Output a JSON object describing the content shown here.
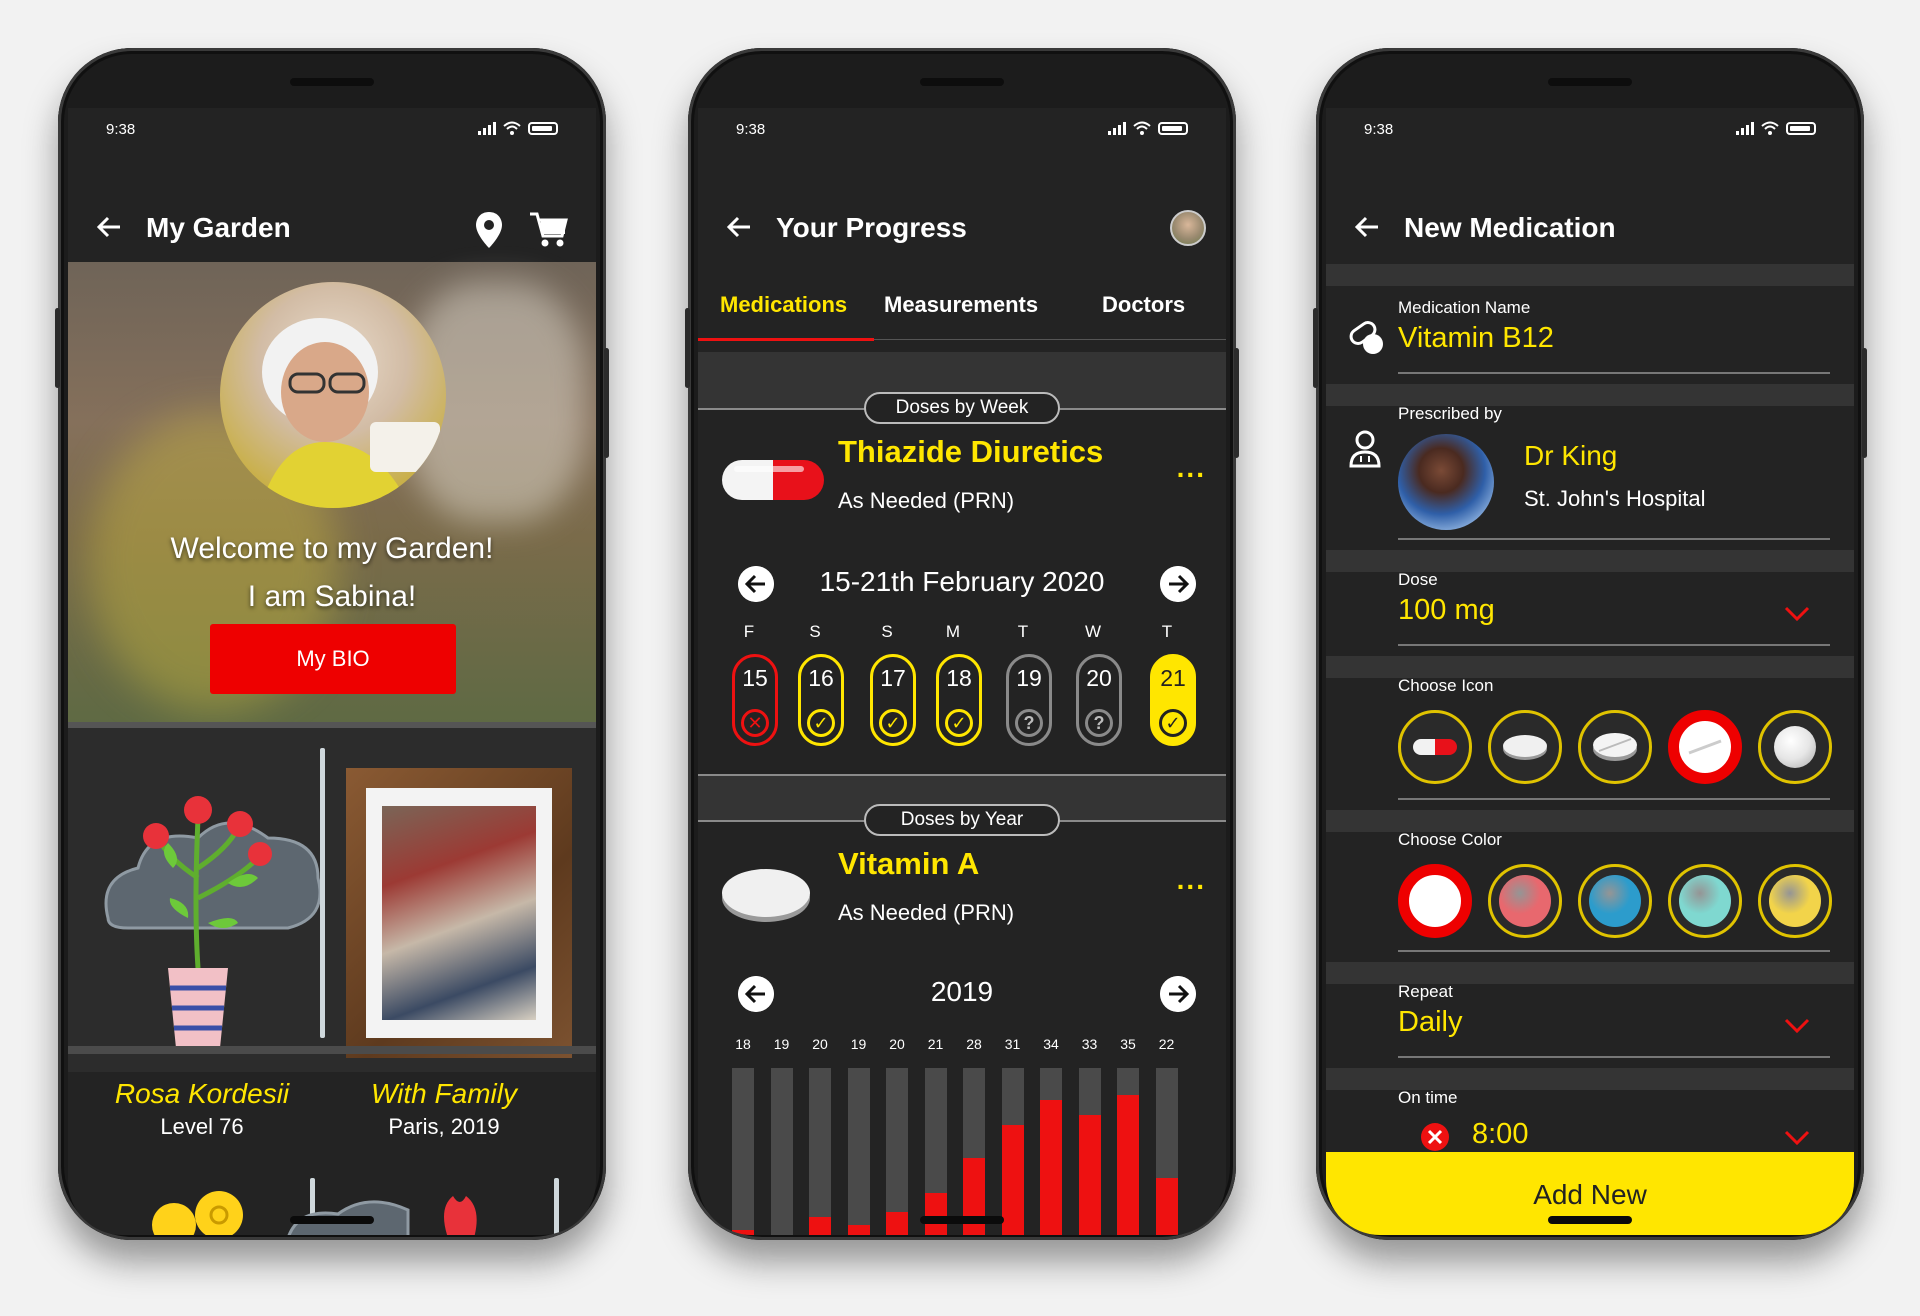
{
  "status": {
    "time": "9:38"
  },
  "garden": {
    "title": "My Garden",
    "welcome": "Welcome to my Garden!",
    "intro": "I am Sabina!",
    "bio_button": "My BIO",
    "items": [
      {
        "title": "Rosa Kordesii",
        "subtitle": "Level 76"
      },
      {
        "title": "With Family",
        "subtitle": "Paris, 2019"
      }
    ]
  },
  "progress": {
    "title": "Your Progress",
    "tabs": [
      "Medications",
      "Measurements",
      "Doctors"
    ],
    "weekly": {
      "section_label": "Doses by Week",
      "name": "Thiazide Diuretics",
      "schedule": "As Needed (PRN)",
      "more": "...",
      "period": "15-21th February 2020",
      "days": [
        {
          "letter": "F",
          "num": "15",
          "status": "missed"
        },
        {
          "letter": "S",
          "num": "16",
          "status": "taken"
        },
        {
          "letter": "S",
          "num": "17",
          "status": "taken"
        },
        {
          "letter": "M",
          "num": "18",
          "status": "taken"
        },
        {
          "letter": "T",
          "num": "19",
          "status": "unknown"
        },
        {
          "letter": "W",
          "num": "20",
          "status": "unknown"
        },
        {
          "letter": "T",
          "num": "21",
          "status": "today"
        }
      ]
    },
    "yearly": {
      "section_label": "Doses by Year",
      "name": "Vitamin A",
      "schedule": "As Needed (PRN)",
      "more": "...",
      "period": "2019",
      "bar_labels": [
        "18",
        "19",
        "20",
        "19",
        "20",
        "21",
        "28",
        "31",
        "34",
        "33",
        "35",
        "22"
      ],
      "bar_fill": [
        0.03,
        0,
        0.11,
        0.06,
        0.14,
        0.25,
        0.46,
        0.66,
        0.81,
        0.72,
        0.84,
        0.34
      ]
    }
  },
  "new_med": {
    "title": "New Medication",
    "name_label": "Medication Name",
    "name_value": "Vitamin B12",
    "prescribed_label": "Prescribed by",
    "doctor_name": "Dr King",
    "hospital": "St. John's Hospital",
    "dose_label": "Dose",
    "dose_value": "100 mg",
    "icon_label": "Choose Icon",
    "icons": [
      "capsule-icon",
      "oval-tablet-icon",
      "round-tablet-icon",
      "round-pill-icon",
      "sphere-pill-icon"
    ],
    "color_label": "Choose Color",
    "colors": [
      "#ffffff",
      "#e8686e",
      "#2c9ccc",
      "#7fd8d0",
      "#f2d44a"
    ],
    "repeat_label": "Repeat",
    "repeat_value": "Daily",
    "time_label": "On time",
    "time_value": "8:00",
    "add_button": "Add New"
  },
  "colors": {
    "accent": "#ffe600",
    "alert": "#ee1111",
    "background": "#232323"
  }
}
